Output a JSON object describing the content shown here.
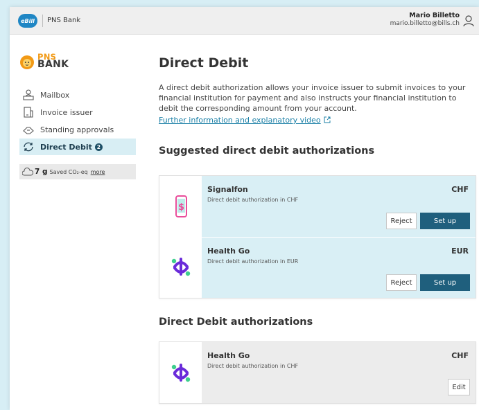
{
  "topbar": {
    "app_logo": "eBill",
    "bank_name": "PNS Bank",
    "user_name": "Mario Billetto",
    "user_email": "mario.billetto@bills.ch"
  },
  "sidebar": {
    "logo_top": "PNS",
    "logo_bottom": "BANK",
    "items": [
      {
        "label": "Mailbox",
        "icon": "mailbox-icon",
        "active": false
      },
      {
        "label": "Invoice issuer",
        "icon": "invoice-issuer-icon",
        "active": false
      },
      {
        "label": "Standing approvals",
        "icon": "handshake-icon",
        "active": false
      },
      {
        "label": "Direct Debit",
        "icon": "refresh-icon",
        "active": true,
        "badge": "2"
      }
    ],
    "co2": {
      "value": "7 g",
      "label": "Saved CO₂-eq",
      "link": "more"
    }
  },
  "main": {
    "title": "Direct Debit",
    "intro": "A direct debit authorization allows your invoice issuer to submit invoices to your financial institution for payment and also instructs your financial institution to debit the corresponding amount from your account.",
    "intro_link": "Further information and explanatory video",
    "suggested_title": "Suggested direct debit authorizations",
    "suggested": [
      {
        "issuer": "Signalfon",
        "description": "Direct debit authorization in CHF",
        "currency": "CHF",
        "reject_label": "Reject",
        "setup_label": "Set up"
      },
      {
        "issuer": "Health Go",
        "description": "Direct debit authorization in EUR",
        "currency": "EUR",
        "reject_label": "Reject",
        "setup_label": "Set up"
      }
    ],
    "authorizations_title": "Direct Debit authorizations",
    "authorizations": [
      {
        "issuer": "Health Go",
        "description": "Direct debit authorization in CHF",
        "currency": "CHF",
        "edit_label": "Edit"
      }
    ]
  },
  "colors": {
    "background": "#d7eef5",
    "accent": "#1f5f7d",
    "suggest_card": "#d9eff5",
    "auth_card": "#ececec",
    "link": "#1a7fa6",
    "brand_orange": "#f29a16"
  }
}
